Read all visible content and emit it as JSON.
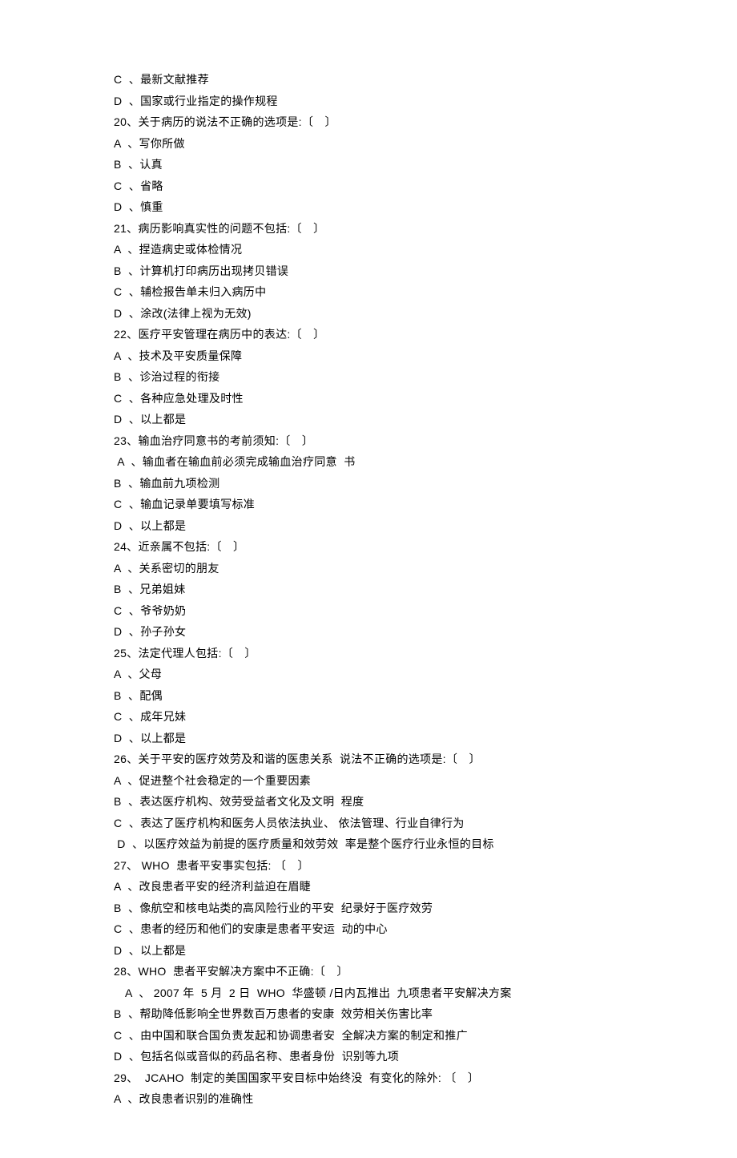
{
  "lines": [
    {
      "text": "C  、最新文献推荐",
      "indent": false
    },
    {
      "text": "D  、国家或行业指定的操作规程",
      "indent": false
    },
    {
      "text": "20、关于病历的说法不正确的选项是:〔　〕",
      "indent": false
    },
    {
      "text": "A  、写你所做",
      "indent": false
    },
    {
      "text": "B  、认真",
      "indent": false
    },
    {
      "text": "C  、省略",
      "indent": false
    },
    {
      "text": "D  、慎重",
      "indent": false
    },
    {
      "text": "21、病历影响真实性的问题不包括:〔　〕",
      "indent": false
    },
    {
      "text": "A  、捏造病史或体检情况",
      "indent": false
    },
    {
      "text": "B  、计算机打印病历出现拷贝错误",
      "indent": false
    },
    {
      "text": "C  、辅检报告单未归入病历中",
      "indent": false
    },
    {
      "text": "D  、涂改(法律上视为无效)",
      "indent": false
    },
    {
      "text": "22、医疗平安管理在病历中的表达:〔　〕",
      "indent": false
    },
    {
      "text": "A  、技术及平安质量保障",
      "indent": false
    },
    {
      "text": "B  、诊治过程的衔接",
      "indent": false
    },
    {
      "text": "C  、各种应急处理及时性",
      "indent": false
    },
    {
      "text": "D  、以上都是",
      "indent": false
    },
    {
      "text": "23、输血治疗同意书的考前须知:〔　〕",
      "indent": false
    },
    {
      "text": " A  、输血者在输血前必须完成输血治疗同意  书",
      "indent": false
    },
    {
      "text": "B  、输血前九项检测",
      "indent": false
    },
    {
      "text": "C  、输血记录单要填写标准",
      "indent": false
    },
    {
      "text": "D  、以上都是",
      "indent": false
    },
    {
      "text": "24、近亲属不包括:〔　〕",
      "indent": false
    },
    {
      "text": "A  、关系密切的朋友",
      "indent": false
    },
    {
      "text": "B  、兄弟姐妹",
      "indent": false
    },
    {
      "text": "C  、爷爷奶奶",
      "indent": false
    },
    {
      "text": "D  、孙子孙女",
      "indent": false
    },
    {
      "text": "25、法定代理人包括:〔　〕",
      "indent": false
    },
    {
      "text": "A  、父母",
      "indent": false
    },
    {
      "text": "B  、配偶",
      "indent": false
    },
    {
      "text": "C  、成年兄妹",
      "indent": false
    },
    {
      "text": "D  、以上都是",
      "indent": false
    },
    {
      "text": "26、关于平安的医疗效劳及和谐的医患关系  说法不正确的选项是:〔　〕",
      "indent": false
    },
    {
      "text": "A  、促进整个社会稳定的一个重要因素",
      "indent": false
    },
    {
      "text": "B  、表达医疗机构、效劳受益者文化及文明  程度",
      "indent": false
    },
    {
      "text": "C  、表达了医疗机构和医务人员依法执业、 依法管理、行业自律行为",
      "indent": false
    },
    {
      "text": " D  、以医疗效益为前提的医疗质量和效劳效  率是整个医疗行业永恒的目标",
      "indent": false
    },
    {
      "text": "27、 WHO  患者平安事实包括: 〔　〕",
      "indent": false
    },
    {
      "text": "A  、改良患者平安的经济利益迫在眉睫",
      "indent": false
    },
    {
      "text": "B  、像航空和核电站类的高风险行业的平安  纪录好于医疗效劳",
      "indent": false
    },
    {
      "text": "C  、患者的经历和他们的安康是患者平安运  动的中心",
      "indent": false
    },
    {
      "text": "D  、以上都是",
      "indent": false
    },
    {
      "text": "28、WHO  患者平安解决方案中不正确:〔　〕",
      "indent": false
    },
    {
      "text": "A  、 2007 年  5 月  2 日  WHO  华盛顿 /日内瓦推出  九项患者平安解决方案",
      "indent": true
    },
    {
      "text": "B  、帮助降低影响全世界数百万患者的安康  效劳相关伤害比率",
      "indent": false
    },
    {
      "text": "C  、由中国和联合国负责发起和协调患者安  全解决方案的制定和推广",
      "indent": false
    },
    {
      "text": "D  、包括名似或音似的药品名称、患者身份  识别等九项",
      "indent": false
    },
    {
      "text": "29、  JCAHO  制定的美国国家平安目标中始终没  有变化的除外: 〔　〕",
      "indent": false
    },
    {
      "text": "A  、改良患者识别的准确性",
      "indent": false
    }
  ]
}
